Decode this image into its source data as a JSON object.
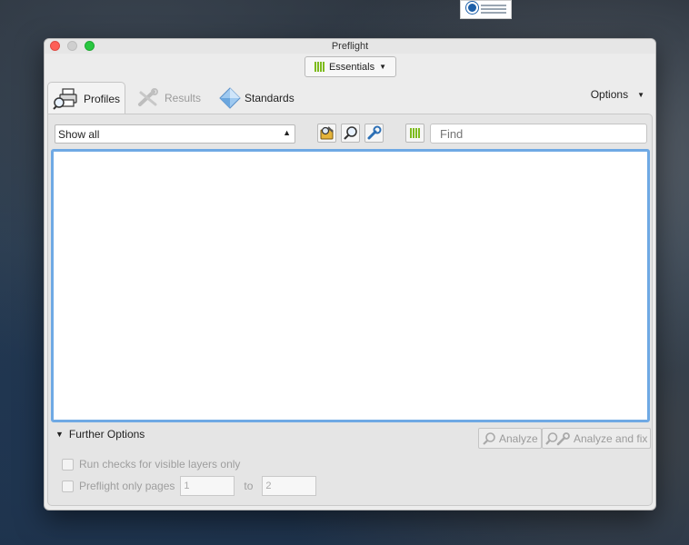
{
  "window": {
    "title": "Preflight"
  },
  "toolbar": {
    "essentials_label": "Essentials"
  },
  "tabs": [
    {
      "label": "Profiles",
      "active": true
    },
    {
      "label": "Results",
      "active": false
    },
    {
      "label": "Standards",
      "active": false
    }
  ],
  "options": {
    "label": "Options"
  },
  "filter": {
    "selected": "Show all"
  },
  "search": {
    "placeholder": "Find"
  },
  "further_options": {
    "label": "Further Options"
  },
  "buttons": {
    "analyze": "Analyze",
    "analyze_and_fix": "Analyze and fix"
  },
  "checks": {
    "visible_layers": "Run checks for visible layers only",
    "pages_only": "Preflight only pages",
    "from": "1",
    "to_label": "to",
    "to": "2"
  },
  "icons": {
    "profiles": "printer-magnifier-icon",
    "results": "wrench-cross-icon",
    "standards": "diamond-icon",
    "essentials": "bars-icon"
  },
  "colors": {
    "accent": "#6fa9e4",
    "essentials_green": "#7dbb1d"
  }
}
